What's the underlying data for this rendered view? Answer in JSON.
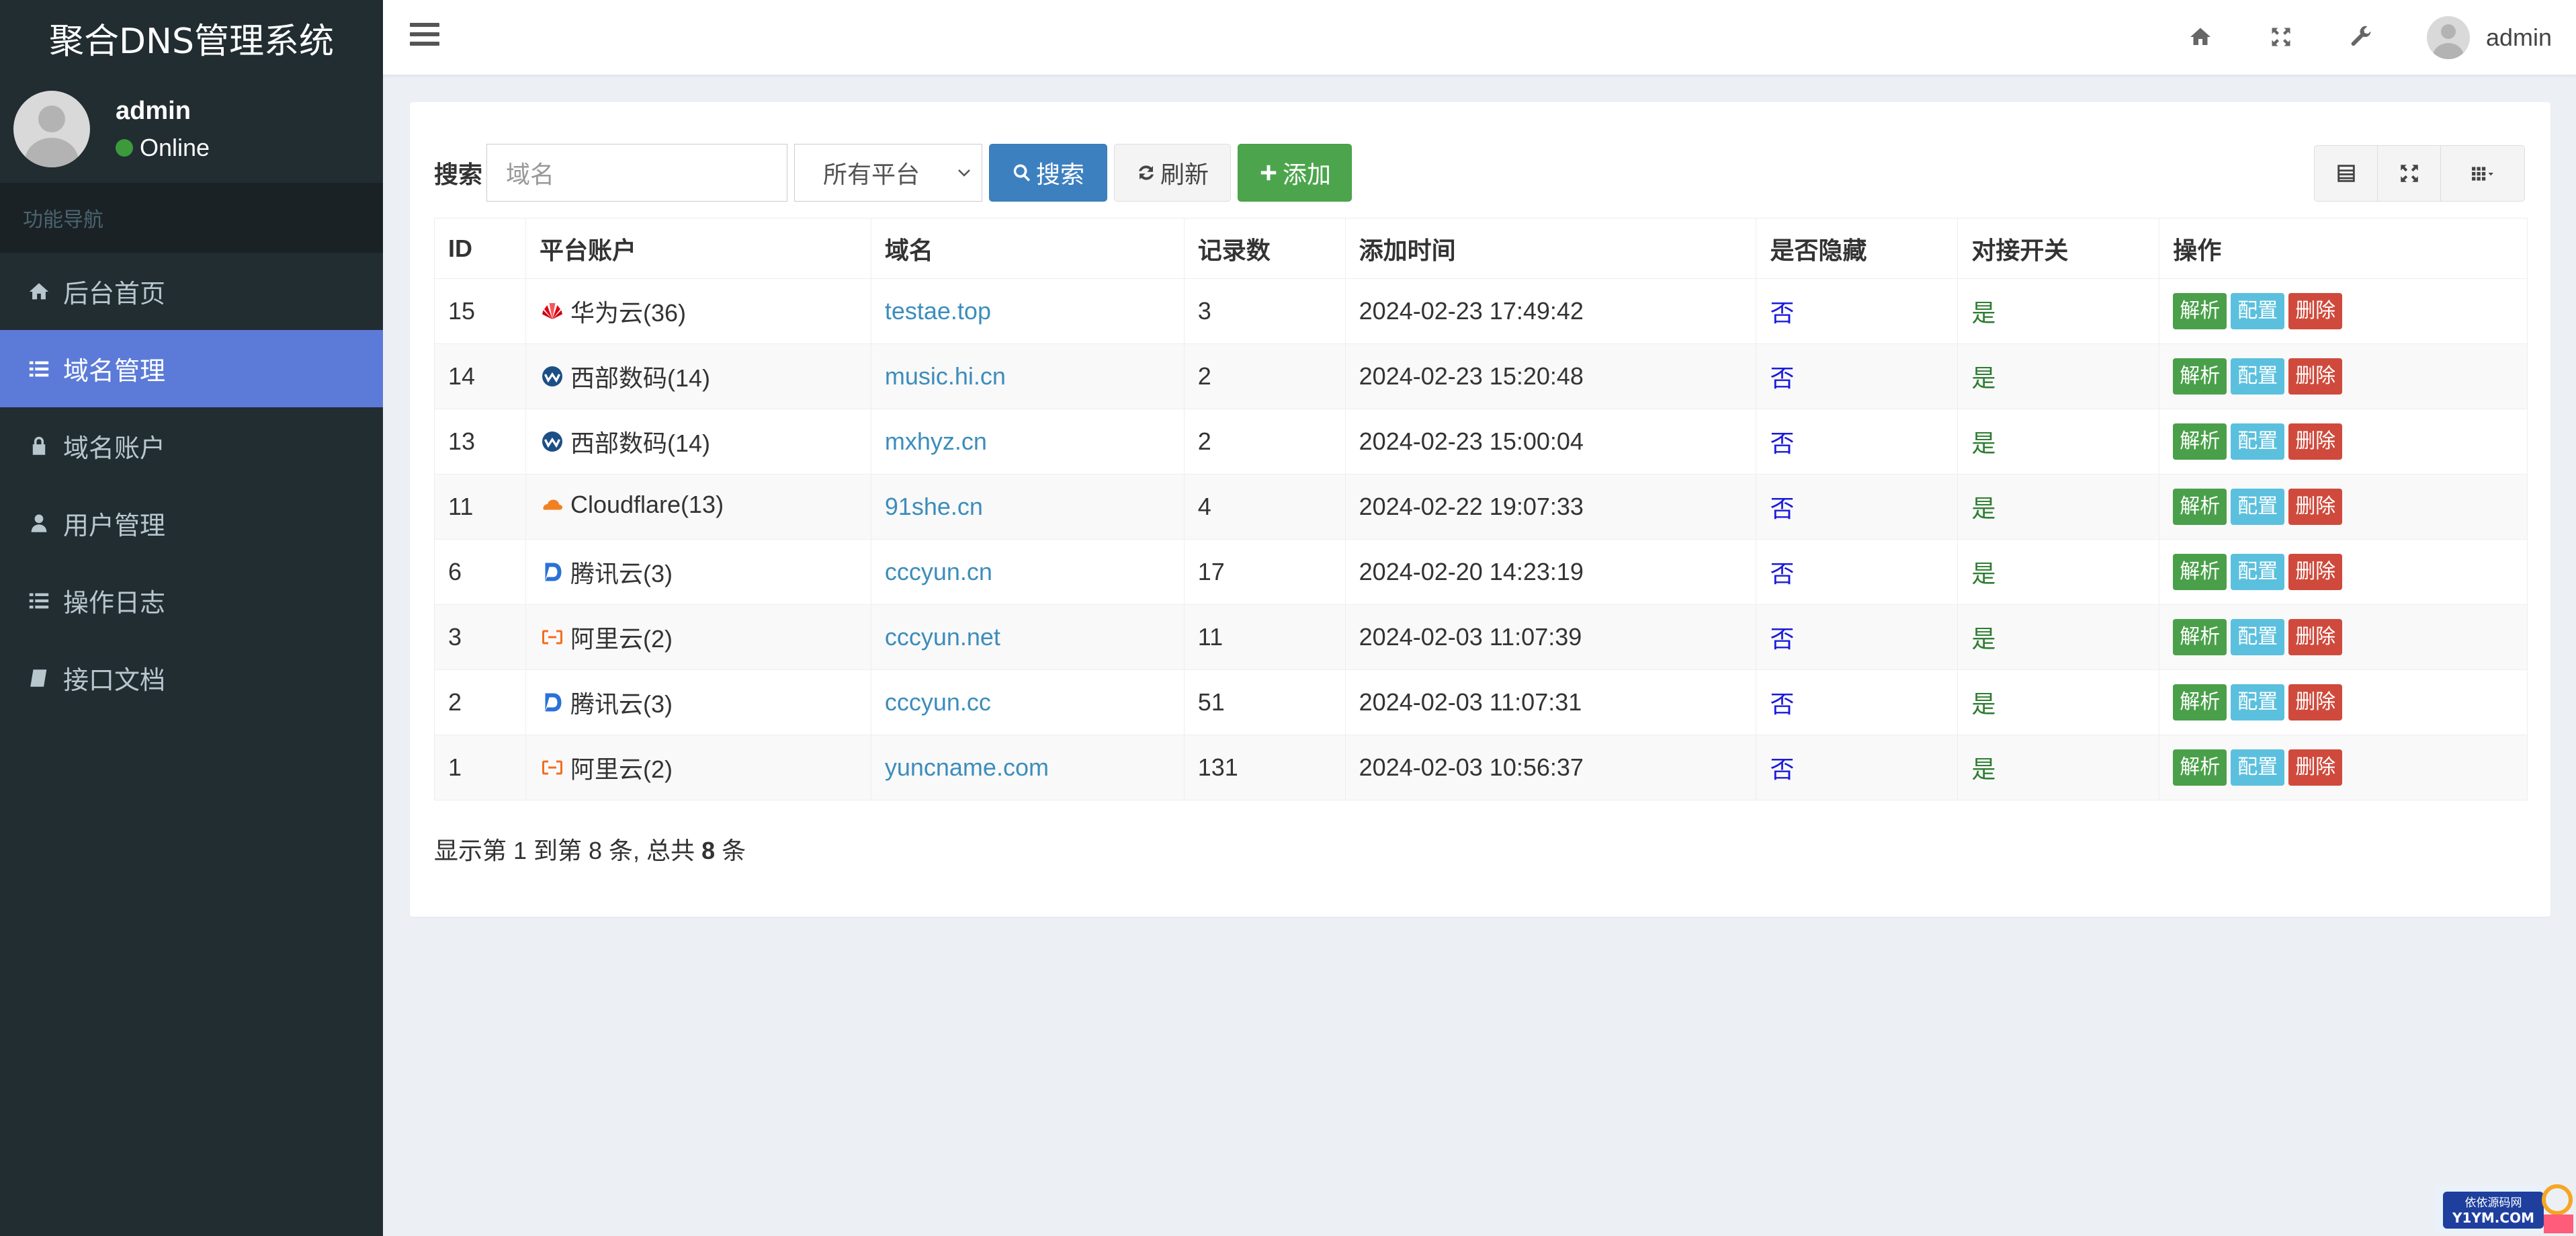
{
  "app": {
    "title": "聚合DNS管理系统"
  },
  "sidebar": {
    "user": {
      "name": "admin",
      "status": "Online"
    },
    "nav_header": "功能导航",
    "items": [
      {
        "label": "后台首页",
        "icon": "home-icon"
      },
      {
        "label": "域名管理",
        "icon": "list-icon",
        "active": true
      },
      {
        "label": "域名账户",
        "icon": "lock-icon"
      },
      {
        "label": "用户管理",
        "icon": "user-icon"
      },
      {
        "label": "操作日志",
        "icon": "list-icon"
      },
      {
        "label": "接口文档",
        "icon": "book-icon"
      }
    ]
  },
  "header": {
    "icons": [
      "home-icon",
      "fullscreen-icon",
      "wrench-icon"
    ],
    "user_name": "admin"
  },
  "toolbar": {
    "search_label": "搜索",
    "search_placeholder": "域名",
    "platform_selected": "所有平台",
    "search_button": "搜索",
    "refresh_button": "刷新",
    "add_button": "添加"
  },
  "table": {
    "columns": [
      "ID",
      "平台账户",
      "域名",
      "记录数",
      "添加时间",
      "是否隐藏",
      "对接开关",
      "操作"
    ],
    "rows": [
      {
        "id": "15",
        "platform": "华为云(36)",
        "platform_icon": "huawei",
        "domain": "testae.top",
        "records": "3",
        "added": "2024-02-23 17:49:42",
        "hidden": "否",
        "switch": "是"
      },
      {
        "id": "14",
        "platform": "西部数码(14)",
        "platform_icon": "west",
        "domain": "music.hi.cn",
        "records": "2",
        "added": "2024-02-23 15:20:48",
        "hidden": "否",
        "switch": "是"
      },
      {
        "id": "13",
        "platform": "西部数码(14)",
        "platform_icon": "west",
        "domain": "mxhyz.cn",
        "records": "2",
        "added": "2024-02-23 15:00:04",
        "hidden": "否",
        "switch": "是"
      },
      {
        "id": "11",
        "platform": "Cloudflare(13)",
        "platform_icon": "cloudflare",
        "domain": "91she.cn",
        "records": "4",
        "added": "2024-02-22 19:07:33",
        "hidden": "否",
        "switch": "是"
      },
      {
        "id": "6",
        "platform": "腾讯云(3)",
        "platform_icon": "dnspod",
        "domain": "cccyun.cn",
        "records": "17",
        "added": "2024-02-20 14:23:19",
        "hidden": "否",
        "switch": "是"
      },
      {
        "id": "3",
        "platform": "阿里云(2)",
        "platform_icon": "aliyun",
        "domain": "cccyun.net",
        "records": "11",
        "added": "2024-02-03 11:07:39",
        "hidden": "否",
        "switch": "是"
      },
      {
        "id": "2",
        "platform": "腾讯云(3)",
        "platform_icon": "dnspod",
        "domain": "cccyun.cc",
        "records": "51",
        "added": "2024-02-03 11:07:31",
        "hidden": "否",
        "switch": "是"
      },
      {
        "id": "1",
        "platform": "阿里云(2)",
        "platform_icon": "aliyun",
        "domain": "yuncname.com",
        "records": "131",
        "added": "2024-02-03 10:56:37",
        "hidden": "否",
        "switch": "是"
      }
    ],
    "actions": {
      "parse": "解析",
      "config": "配置",
      "delete": "删除"
    }
  },
  "pagination": {
    "prefix": "显示第 1 到第 8 条, 总共 ",
    "total": "8",
    "suffix": " 条"
  },
  "watermark": {
    "line1": "依依源码网",
    "line2": "Y1YM.COM"
  },
  "colors": {
    "sidebar_bg": "#222d32",
    "active_nav": "#5c7bd8",
    "primary": "#3d80c0",
    "success": "#4ca54c",
    "info": "#5bc0de",
    "danger": "#cf4a3c"
  }
}
